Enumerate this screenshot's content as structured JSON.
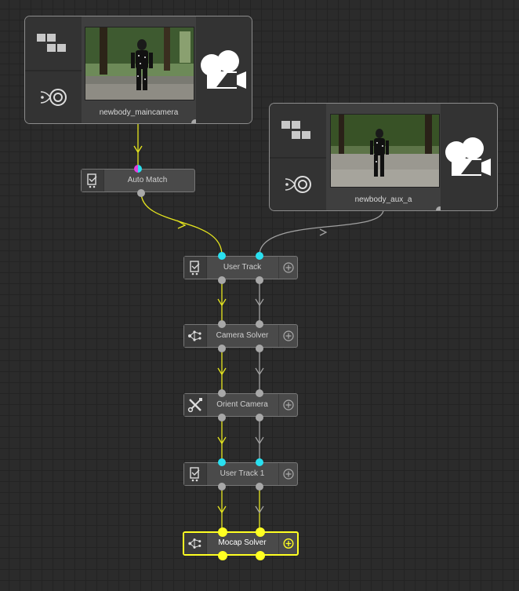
{
  "camera_nodes": [
    {
      "id": "main",
      "label": "newbody_maincamera",
      "icon": "video-camera-icon"
    },
    {
      "id": "aux",
      "label": "newbody_aux_a",
      "icon": "video-camera-icon"
    }
  ],
  "nodes": {
    "auto_match": {
      "label": "Auto Match",
      "icon": "auto-match-icon"
    },
    "user_track": {
      "label": "User Track",
      "icon": "user-track-icon"
    },
    "camera_solver": {
      "label": "Camera Solver",
      "icon": "solver-icon"
    },
    "orient_camera": {
      "label": "Orient Camera",
      "icon": "tools-icon"
    },
    "user_track_1": {
      "label": "User Track 1",
      "icon": "user-track-icon"
    },
    "mocap_solver": {
      "label": "Mocap Solver",
      "icon": "solver-icon",
      "selected": true
    }
  },
  "colors": {
    "yellow_wire": "#e6e61e",
    "grey_wire": "#a0a0a0",
    "selected": "#ffff22",
    "cyan_port": "#29e0f0",
    "magenta_port": "#e040e0"
  }
}
